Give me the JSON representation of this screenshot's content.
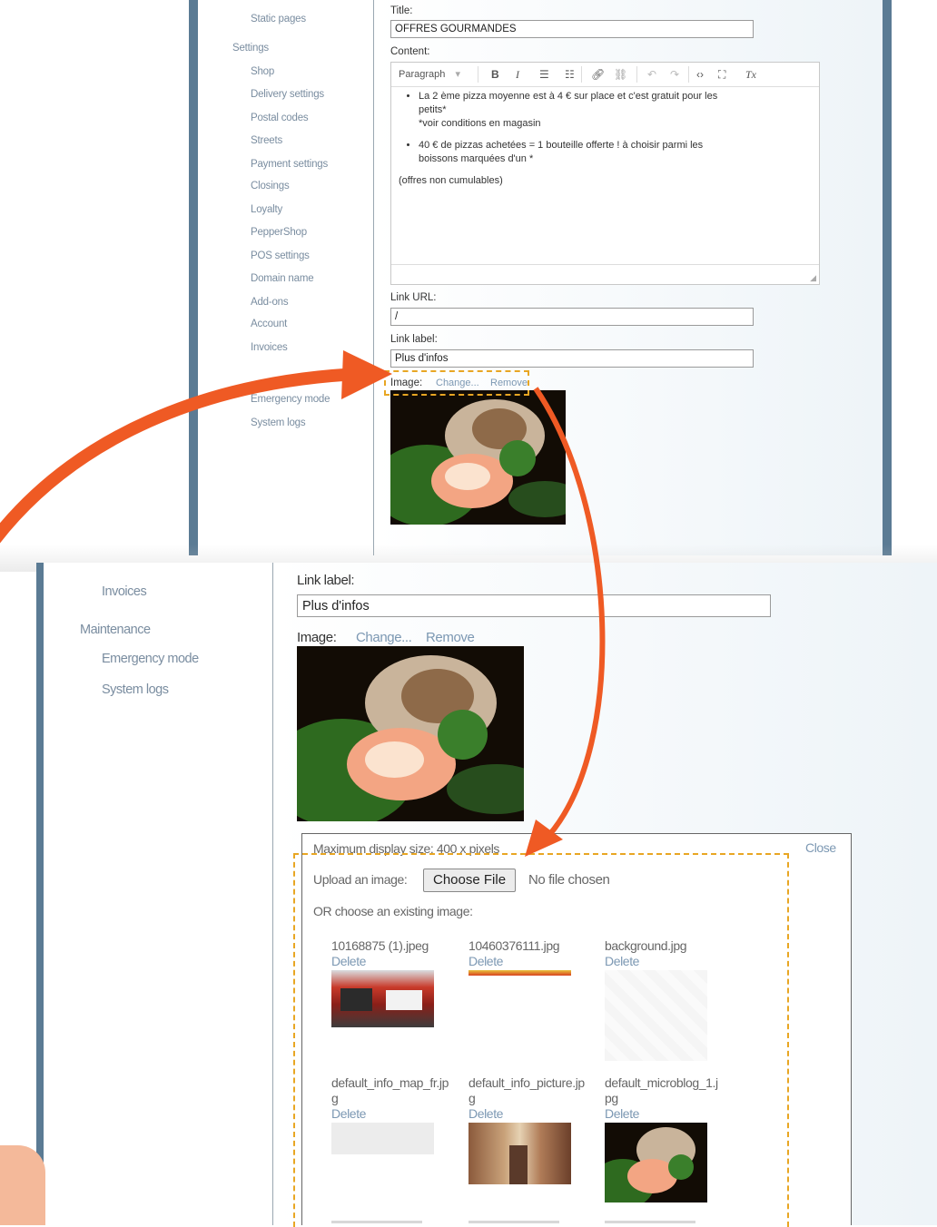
{
  "top": {
    "sidebar": {
      "items": [
        "Static pages",
        "Settings",
        "Shop",
        "Delivery settings",
        "Postal codes",
        "Streets",
        "Payment settings",
        "Closings",
        "Loyalty",
        "PepperShop",
        "POS settings",
        "Domain name",
        "Add-ons",
        "Account",
        "Invoices",
        "Emergency mode",
        "System logs"
      ]
    },
    "form": {
      "title_label": "Title:",
      "title_value": "OFFRES GOURMANDES",
      "content_label": "Content:",
      "toolbar": {
        "format_select": "Paragraph",
        "bold": "B",
        "italic": "I",
        "clear_format": "Tx"
      },
      "content": {
        "bullet1_line1": "La 2 ème pizza moyenne est à 4 € sur place et c'est gratuit pour les",
        "bullet1_line2": "petits*",
        "bullet1_line3": "*voir conditions en magasin",
        "bullet2_line1": "40 € de pizzas achetées  = 1 bouteille offerte ! à choisir parmi les",
        "bullet2_line2": "boissons marquées d'un *",
        "paragraph": "(offres non cumulables)"
      },
      "link_url_label": "Link URL:",
      "link_url_value": "/",
      "link_label_label": "Link label:",
      "link_label_value": "Plus d'infos",
      "image_label": "Image:",
      "image_change": "Change...",
      "image_remove": "Remove"
    }
  },
  "bottom": {
    "sidebar": {
      "invoices": "Invoices",
      "maintenance": "Maintenance",
      "emergency": "Emergency mode",
      "logs": "System logs"
    },
    "form": {
      "link_label_label": "Link label:",
      "link_label_value": "Plus d'infos",
      "image_label": "Image:",
      "image_change": "Change...",
      "image_remove": "Remove"
    },
    "panel": {
      "max_size": "Maximum display size: 400 x pixels",
      "close": "Close",
      "upload_label": "Upload an image:",
      "choose_file": "Choose File",
      "no_file": "No file chosen",
      "or_choose": "OR choose an existing image:",
      "delete_label": "Delete",
      "images": [
        {
          "name": "10168875 (1).jpeg"
        },
        {
          "name": "10460376111.jpg"
        },
        {
          "name": "background.jpg"
        },
        {
          "name": "default_info_map_fr.jpg"
        },
        {
          "name": "default_info_picture.jpg"
        },
        {
          "name": "default_microblog_1.jpg"
        }
      ]
    }
  },
  "colors": {
    "frame": "#5b7b94",
    "link": "#7c98b3",
    "arrow": "#ef5a24",
    "highlight": "#e8a623"
  }
}
